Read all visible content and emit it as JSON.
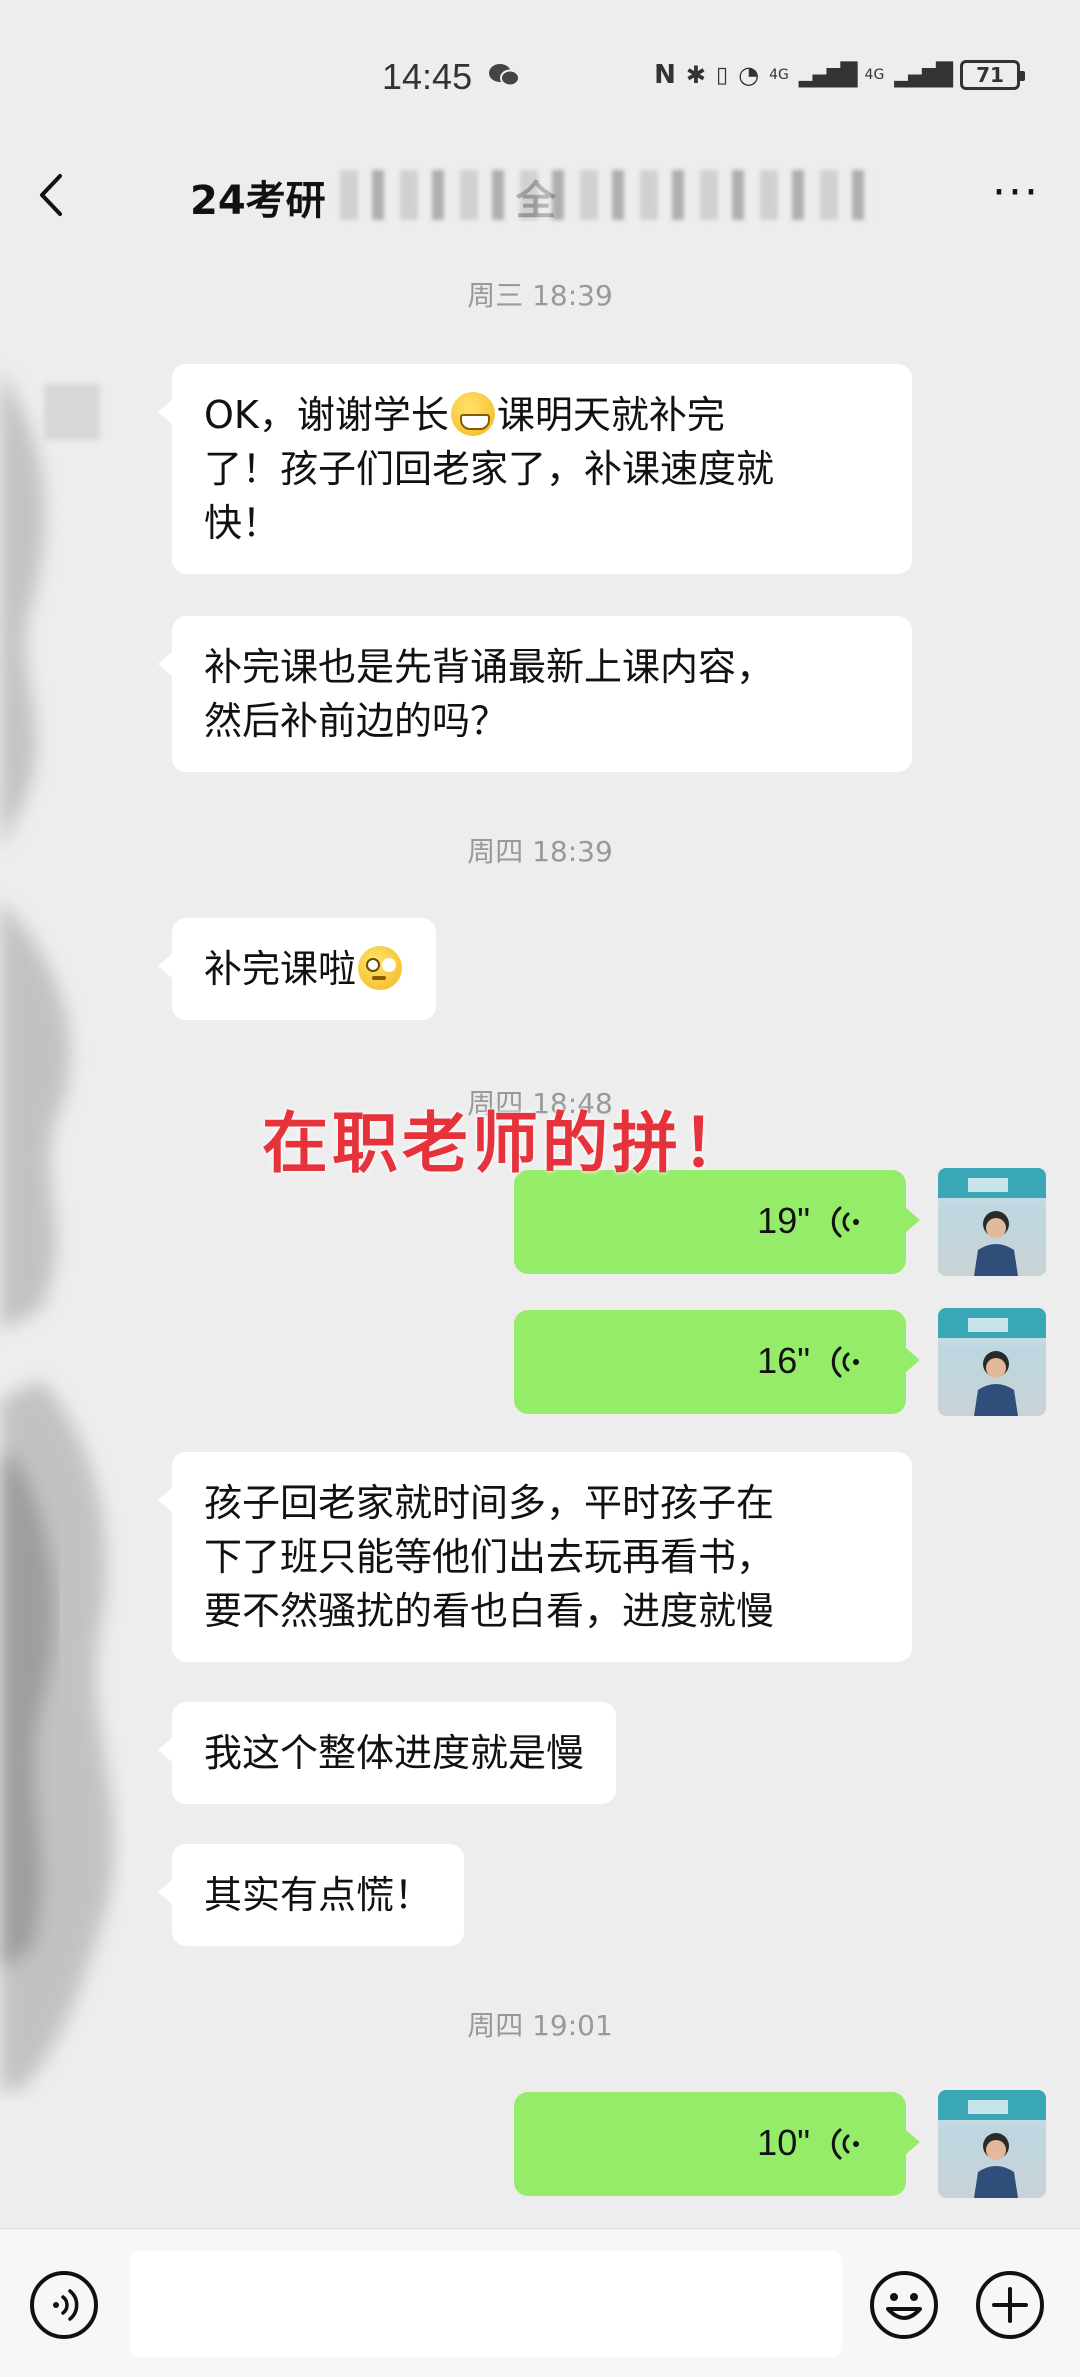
{
  "status_bar": {
    "time": "14:45",
    "network_1": "4G",
    "network_2": "4G",
    "battery": "71"
  },
  "header": {
    "title": "24考研",
    "title_suffix": "全",
    "back_icon": "chevron-left-icon",
    "more_icon": "more-dots-icon"
  },
  "messages": [
    {
      "type": "time",
      "text": "周三 18:39"
    },
    {
      "type": "incoming",
      "lines": [
        "OK，谢谢学长",
        "课明天就补完",
        "了！孩子们回老家了，补课速度就",
        "快！"
      ]
    },
    {
      "type": "incoming",
      "lines": [
        "补完课也是先背诵最新上课内容，",
        "然后补前边的吗？"
      ]
    },
    {
      "type": "time",
      "text": "周四 18:39"
    },
    {
      "type": "incoming",
      "text": "补完课啦"
    },
    {
      "type": "time",
      "text": "周四 18:48"
    },
    {
      "type": "outgoing_voice",
      "duration": "19\""
    },
    {
      "type": "outgoing_voice",
      "duration": "16\""
    },
    {
      "type": "incoming",
      "lines": [
        "孩子回老家就时间多，平时孩子在",
        "下了班只能等他们出去玩再看书，",
        "要不然骚扰的看也白看，进度就慢"
      ]
    },
    {
      "type": "incoming",
      "text": "我这个整体进度就是慢"
    },
    {
      "type": "incoming",
      "text": "其实有点慌！"
    },
    {
      "type": "time",
      "text": "周四 19:01"
    },
    {
      "type": "outgoing_voice",
      "duration": "10\""
    }
  ],
  "overlay_caption": "在职老师的拼！",
  "input_bar": {
    "voice_icon": "voice-toggle-icon",
    "emoji_icon": "emoji-icon",
    "plus_icon": "plus-icon"
  },
  "colors": {
    "background": "#ededed",
    "incoming_bubble": "#ffffff",
    "outgoing_bubble": "#95ec69",
    "caption": "#e5323b",
    "timestamp": "#999999"
  }
}
